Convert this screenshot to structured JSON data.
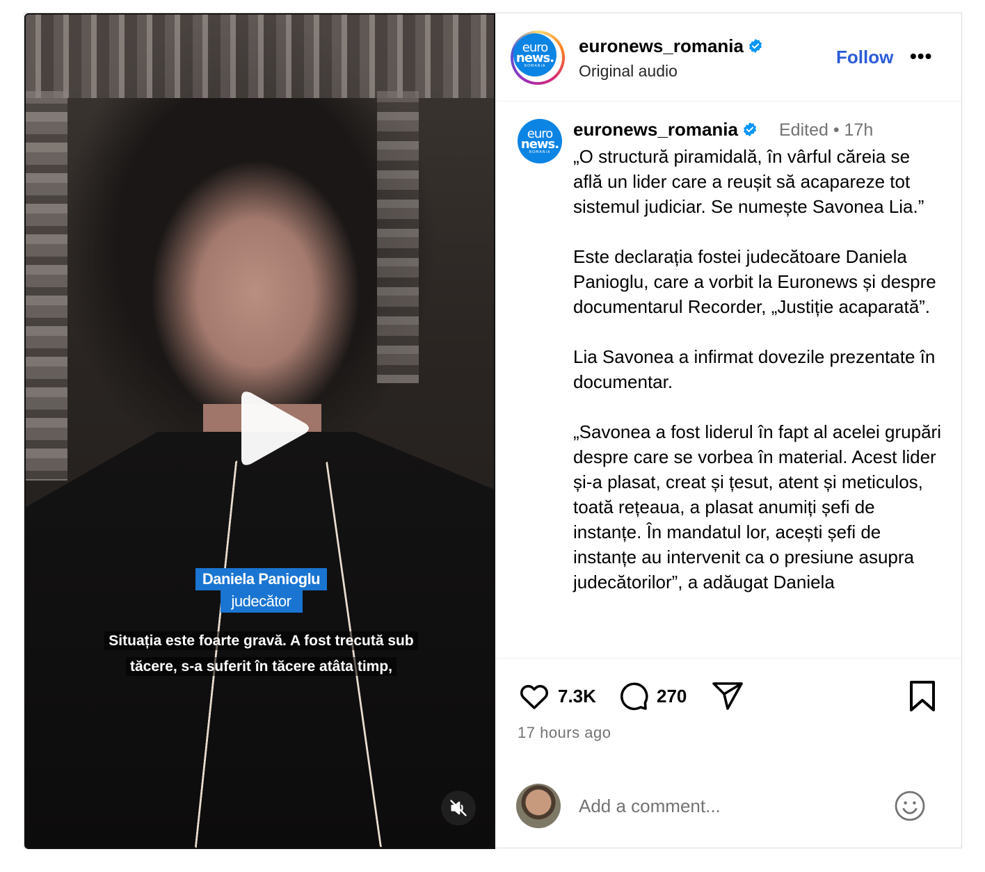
{
  "video": {
    "nameplate_name": "Daniela Panioglu",
    "nameplate_role": "judecător",
    "subtitle_line1": "Situația este foarte gravă. A fost trecută sub",
    "subtitle_line2": "tăcere, s-a suferit în tăcere atâta timp,",
    "icons": {
      "play": "play-icon",
      "mute": "mute-icon"
    }
  },
  "header": {
    "username": "euronews_romania",
    "subtitle": "Original audio",
    "follow_label": "Follow",
    "more_label": "•••",
    "logo": {
      "line1": "euro",
      "line2": "news.",
      "line3": "ROMANIA"
    }
  },
  "caption": {
    "username": "euronews_romania",
    "meta": "Edited  •  17h",
    "text": "„O structură piramidală, în vârful căreia se află un lider care a reușit să acapareze tot sistemul judiciar. Se numește Savonea Lia.”\n\nEste declarația fostei judecătoare Daniela Panioglu, care a vorbit la Euronews și despre documentarul Recorder, „Justiție acaparată”.\n\nLia Savonea a infirmat dovezile prezentate în documentar.\n\n„Savonea a fost liderul în fapt al acelei grupări despre care se vorbea în material. Acest lider și-a plasat, creat și țesut, atent și meticulos, toată rețeaua, a plasat anumiți șefi de instanțe. În mandatul lor, acești șefi de instanțe au intervenit ca o presiune asupra judecătorilor”, a adăugat Daniela"
  },
  "actions": {
    "likes": "7.3K",
    "comments": "270",
    "time_ago": "17 hours ago"
  },
  "comment": {
    "placeholder": "Add a comment..."
  },
  "colors": {
    "accent_blue": "#2a5bd7",
    "verified_blue": "#0095f6",
    "euronews_blue": "#0c84e4",
    "muted_text": "#737373"
  }
}
